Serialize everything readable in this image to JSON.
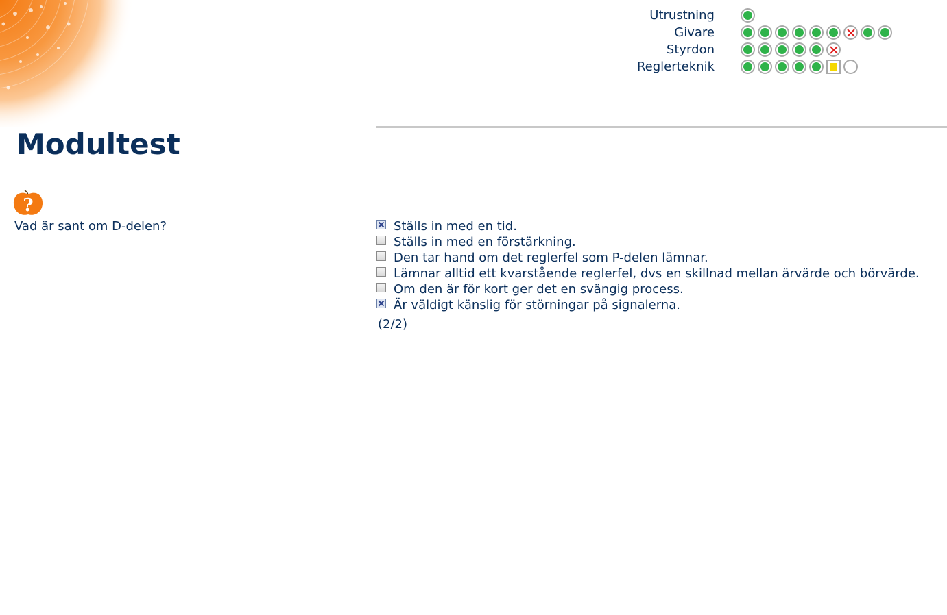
{
  "progress": [
    {
      "label": "Utrustning",
      "states": [
        "ok"
      ]
    },
    {
      "label": "Givare",
      "states": [
        "ok",
        "ok",
        "ok",
        "ok",
        "ok",
        "ok",
        "wrong",
        "ok",
        "ok"
      ]
    },
    {
      "label": "Styrdon",
      "states": [
        "ok",
        "ok",
        "ok",
        "ok",
        "ok",
        "wrong"
      ]
    },
    {
      "label": "Reglerteknik",
      "states": [
        "ok",
        "ok",
        "ok",
        "ok",
        "ok",
        "current",
        "empty"
      ]
    }
  ],
  "page": {
    "title": "Modultest"
  },
  "question": {
    "icon": "question-apple-icon",
    "text": "Vad är sant om D-delen?",
    "options": [
      {
        "label": "Ställs in med en tid.",
        "checked": true
      },
      {
        "label": "Ställs in med en förstärkning.",
        "checked": false
      },
      {
        "label": "Den tar hand om det reglerfel som P-delen lämnar.",
        "checked": false
      },
      {
        "label": "Lämnar alltid ett kvarstående reglerfel, dvs en skillnad mellan ärvärde och börvärde.",
        "checked": false
      },
      {
        "label": "Om den är för kort ger det en svängig process.",
        "checked": false
      },
      {
        "label": "Är väldigt känslig för störningar på signalerna.",
        "checked": true
      }
    ],
    "counter": "(2/2)"
  },
  "colors": {
    "accent": "#f5821f",
    "text": "#0b2f5b",
    "ok": "#2fb34a",
    "wrong": "#e01818",
    "current": "#f5d800"
  }
}
